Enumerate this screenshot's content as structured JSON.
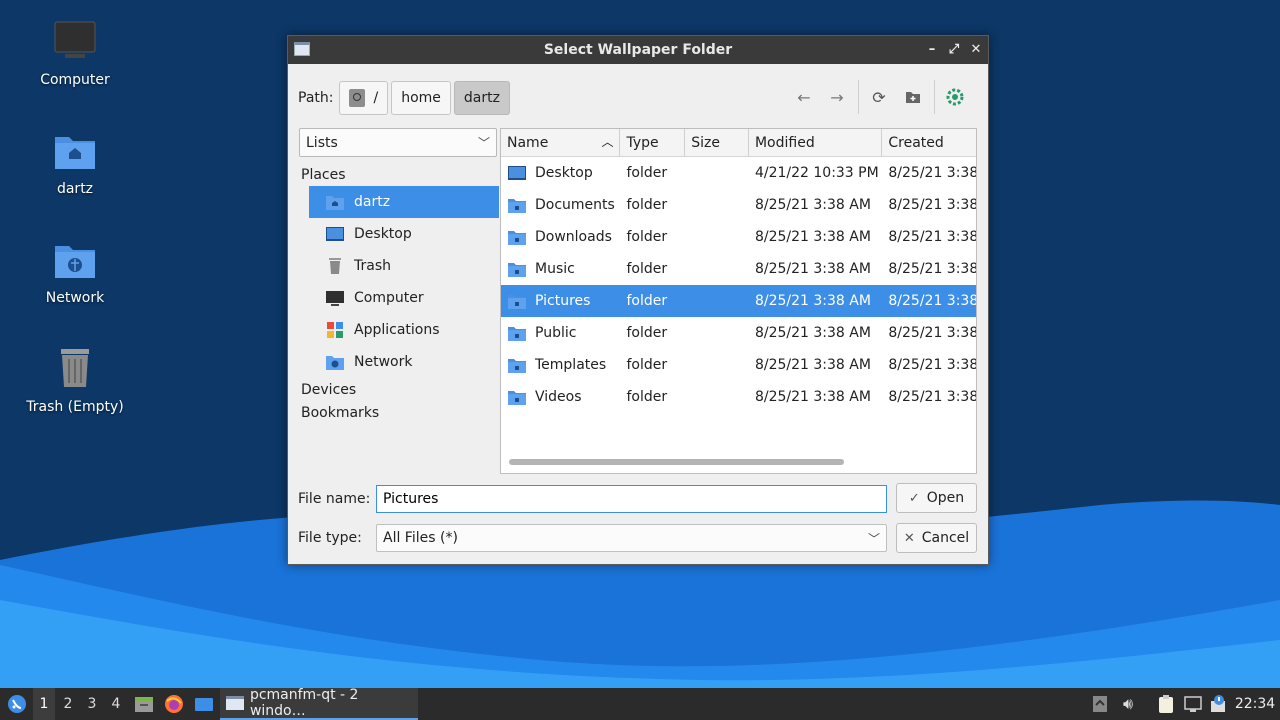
{
  "desktop": {
    "icons": [
      {
        "label": "Computer"
      },
      {
        "label": "dartz"
      },
      {
        "label": "Network"
      },
      {
        "label": "Trash (Empty)"
      }
    ]
  },
  "dialog": {
    "title": "Select Wallpaper Folder",
    "path_label": "Path:",
    "breadcrumbs": [
      "/",
      "home",
      "dartz"
    ],
    "view_mode": "Lists",
    "sidebar": {
      "places_heading": "Places",
      "places": [
        {
          "label": "dartz",
          "icon": "home-folder-icon"
        },
        {
          "label": "Desktop",
          "icon": "desktop-icon"
        },
        {
          "label": "Trash",
          "icon": "trash-icon"
        },
        {
          "label": "Computer",
          "icon": "computer-icon"
        },
        {
          "label": "Applications",
          "icon": "applications-icon"
        },
        {
          "label": "Network",
          "icon": "network-folder-icon"
        }
      ],
      "devices_heading": "Devices",
      "bookmarks_heading": "Bookmarks"
    },
    "columns": [
      "Name",
      "Type",
      "Size",
      "Modified",
      "Created"
    ],
    "files": [
      {
        "name": "Desktop",
        "type": "folder",
        "size": "",
        "modified": "4/21/22 10:33 PM",
        "created": "8/25/21 3:38",
        "icon": "desktop-folder-icon"
      },
      {
        "name": "Documents",
        "type": "folder",
        "size": "",
        "modified": "8/25/21 3:38 AM",
        "created": "8/25/21 3:38",
        "icon": "documents-folder-icon"
      },
      {
        "name": "Downloads",
        "type": "folder",
        "size": "",
        "modified": "8/25/21 3:38 AM",
        "created": "8/25/21 3:38",
        "icon": "downloads-folder-icon"
      },
      {
        "name": "Music",
        "type": "folder",
        "size": "",
        "modified": "8/25/21 3:38 AM",
        "created": "8/25/21 3:38",
        "icon": "music-folder-icon"
      },
      {
        "name": "Pictures",
        "type": "folder",
        "size": "",
        "modified": "8/25/21 3:38 AM",
        "created": "8/25/21 3:38",
        "icon": "pictures-folder-icon"
      },
      {
        "name": "Public",
        "type": "folder",
        "size": "",
        "modified": "8/25/21 3:38 AM",
        "created": "8/25/21 3:38",
        "icon": "public-folder-icon"
      },
      {
        "name": "Templates",
        "type": "folder",
        "size": "",
        "modified": "8/25/21 3:38 AM",
        "created": "8/25/21 3:38",
        "icon": "templates-folder-icon"
      },
      {
        "name": "Videos",
        "type": "folder",
        "size": "",
        "modified": "8/25/21 3:38 AM",
        "created": "8/25/21 3:38",
        "icon": "videos-folder-icon"
      }
    ],
    "selected_file": "Pictures",
    "file_name_label": "File name:",
    "file_name_value": "Pictures",
    "file_type_label": "File type:",
    "file_type_value": "All Files (*)",
    "open_label": "Open",
    "cancel_label": "Cancel"
  },
  "taskbar": {
    "workspaces": [
      "1",
      "2",
      "3",
      "4"
    ],
    "current_workspace": "1",
    "window_task_label": "pcmanfm-qt - 2 windo…",
    "clock": "22:34"
  },
  "colors": {
    "accent": "#3d8ee6",
    "desktop_bg": "#0c3766",
    "titlebar": "#3a3a3a",
    "taskbar": "#2b2b2b"
  }
}
